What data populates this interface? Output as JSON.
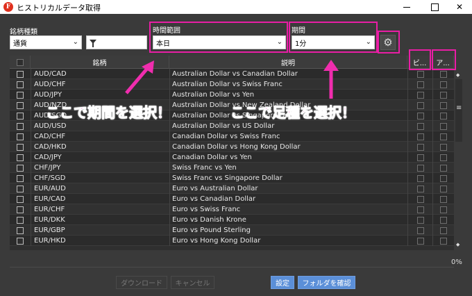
{
  "window": {
    "title": "ヒストリカルデータ取得",
    "icon_letter": "F",
    "buttons": [
      "minimize",
      "maximize",
      "close"
    ]
  },
  "filters": {
    "symbol_type_label": "銘柄種類",
    "symbol_type_value": "通貨",
    "time_range_label": "時間範囲",
    "time_range_value": "本日",
    "period_label": "期間",
    "period_value": "1分"
  },
  "table": {
    "headers": {
      "symbol": "銘柄",
      "description": "説明",
      "col_b1": "ビ...",
      "col_b2": "ア..."
    },
    "rows": [
      {
        "symbol": "AUD/CAD",
        "desc": "Australian Dollar vs Canadian Dollar"
      },
      {
        "symbol": "AUD/CHF",
        "desc": "Australian Dollar vs Swiss Franc"
      },
      {
        "symbol": "AUD/JPY",
        "desc": "Australian Dollar vs Yen"
      },
      {
        "symbol": "AUD/NZD",
        "desc": "Australian Dollar vs New Zealand Dollar"
      },
      {
        "symbol": "AUD/SGD",
        "desc": "Australian Dollar vs Singapore Dollar"
      },
      {
        "symbol": "AUD/USD",
        "desc": "Australian Dollar vs US Dollar"
      },
      {
        "symbol": "CAD/CHF",
        "desc": "Canadian Dollar vs Swiss Franc"
      },
      {
        "symbol": "CAD/HKD",
        "desc": "Canadian Dollar vs Hong Kong Dollar"
      },
      {
        "symbol": "CAD/JPY",
        "desc": "Canadian Dollar vs Yen"
      },
      {
        "symbol": "CHF/JPY",
        "desc": "Swiss Franc vs Yen"
      },
      {
        "symbol": "CHF/SGD",
        "desc": "Swiss Franc vs Singapore Dollar"
      },
      {
        "symbol": "EUR/AUD",
        "desc": "Euro vs Australian Dollar"
      },
      {
        "symbol": "EUR/CAD",
        "desc": "Euro vs Canadian Dollar"
      },
      {
        "symbol": "EUR/CHF",
        "desc": "Euro vs Swiss Franc"
      },
      {
        "symbol": "EUR/DKK",
        "desc": "Euro vs Danish Krone"
      },
      {
        "symbol": "EUR/GBP",
        "desc": "Euro vs Pound Sterling"
      },
      {
        "symbol": "EUR/HKD",
        "desc": "Euro vs Hong Kong Dollar"
      }
    ]
  },
  "progress": {
    "percent_label": "0%"
  },
  "footer": {
    "download": "ダウンロード",
    "cancel": "キャンセル",
    "settings": "設定",
    "open_folder": "フォルダを確認"
  },
  "annotations": {
    "period_note": "ここで期間を選択！",
    "timeframe_note": "ここで足種を選択！"
  },
  "colors": {
    "highlight": "#e91ea5",
    "primary_button": "#5b8fd8",
    "background": "#3a3a3a"
  },
  "icons": [
    "app-logo-icon",
    "filter-icon",
    "gear-icon",
    "chevron-down-icon",
    "checkbox",
    "scroll-up-icon",
    "scroll-down-icon"
  ]
}
